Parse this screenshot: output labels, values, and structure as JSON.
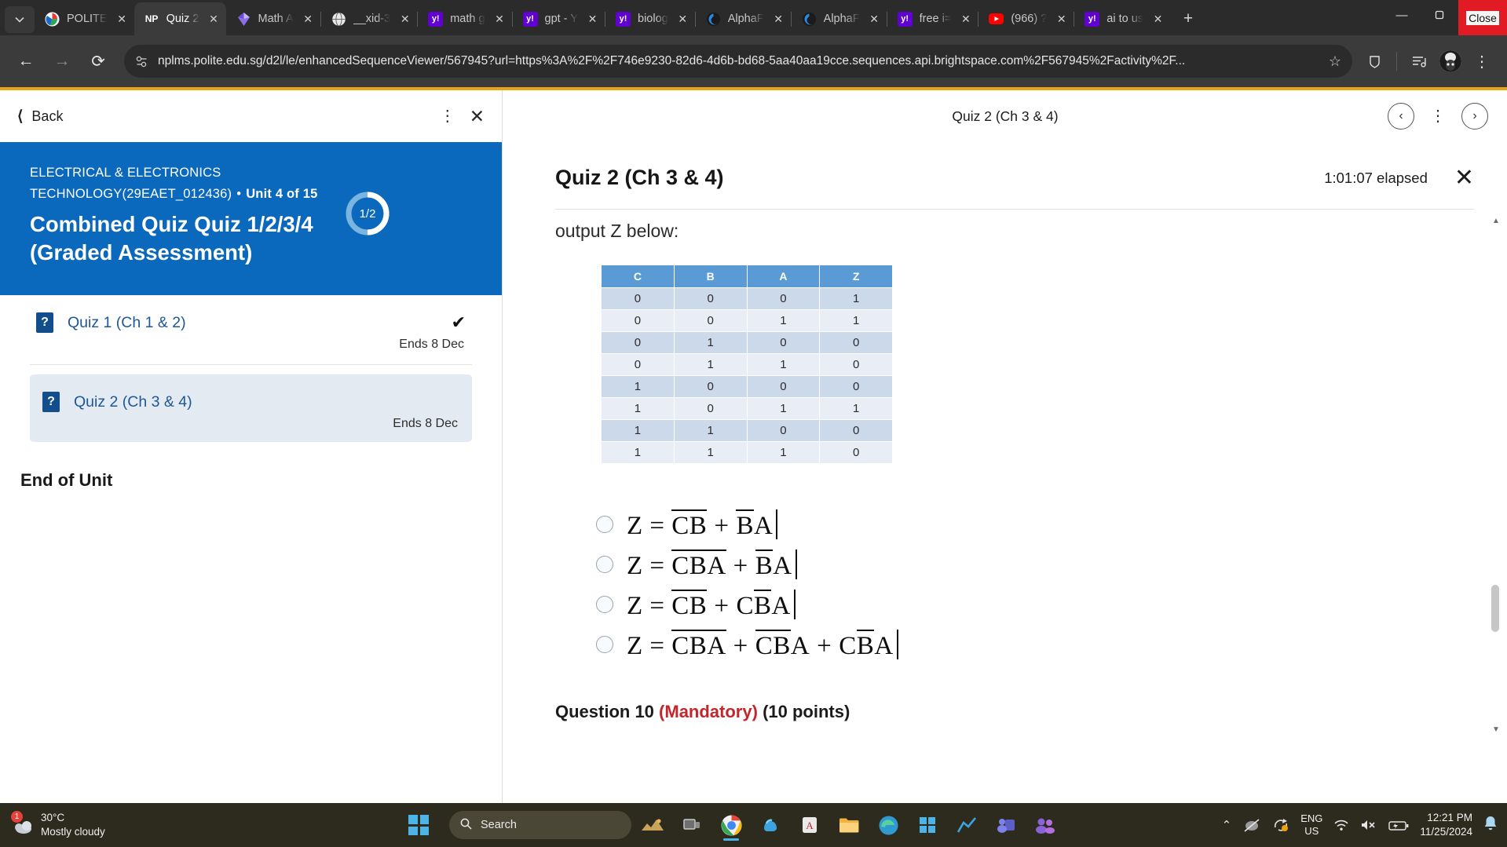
{
  "browser": {
    "tabs": [
      {
        "title": "POLITE",
        "favicon_kind": "polite",
        "active": false
      },
      {
        "title": "Quiz 2",
        "favicon_kind": "np",
        "active": true
      },
      {
        "title": "Math A",
        "favicon_kind": "gem",
        "active": false
      },
      {
        "title": "__xid-3",
        "favicon_kind": "globe",
        "active": false
      },
      {
        "title": "math g",
        "favicon_kind": "yahoo",
        "active": false
      },
      {
        "title": "gpt - Y",
        "favicon_kind": "yahoo",
        "active": false
      },
      {
        "title": "biolog",
        "favicon_kind": "yahoo",
        "active": false
      },
      {
        "title": "AlphaF",
        "favicon_kind": "alpha",
        "active": false
      },
      {
        "title": "AlphaF",
        "favicon_kind": "alpha",
        "active": false
      },
      {
        "title": "free i=",
        "favicon_kind": "yahoo",
        "active": false
      },
      {
        "title": "(966) ?",
        "favicon_kind": "youtube",
        "active": false
      },
      {
        "title": "ai to us",
        "favicon_kind": "yahoo",
        "active": false
      }
    ],
    "tab_close_label": "✕",
    "newtab_label": "+",
    "window": {
      "minimize": "—",
      "restore": "❐",
      "close_tooltip": "Close"
    },
    "nav": {
      "back": "←",
      "forward": "→",
      "reload": "⟳"
    },
    "url": "nplms.polite.edu.sg/d2l/le/enhancedSequenceViewer/567945?url=https%3A%2F%2F746e9230-82d6-4d6b-bd68-5aa40aa19cce.sequences.api.brightspace.com%2F567945%2Factivity%2F...",
    "star_label": "☆"
  },
  "left_panel": {
    "back_label": "Back",
    "hero": {
      "course_line1": "ELECTRICAL & ELECTRONICS",
      "course_line2": "TECHNOLOGY(29EAET_012436)",
      "unit_label": "Unit 4 of 15",
      "title": "Combined Quiz Quiz 1/2/3/4 (Graded Assessment)",
      "progress_label": "1/2",
      "progress_percent": 50,
      "bg_color": "#0a69bc"
    },
    "items": [
      {
        "title": "Quiz 1 (Ch 1 & 2)",
        "due": "Ends 8 Dec",
        "completed": true,
        "selected": false,
        "icon": "?"
      },
      {
        "title": "Quiz 2 (Ch 3 & 4)",
        "due": "Ends 8 Dec",
        "completed": false,
        "selected": true,
        "icon": "?"
      }
    ],
    "end_of_unit": "End of Unit"
  },
  "right_panel": {
    "header_title": "Quiz 2 (Ch 3 & 4)",
    "prev_label": "‹",
    "next_label": "›",
    "kebab_label": "⋮",
    "quiz_title": "Quiz 2 (Ch 3 & 4)",
    "timer": "1:01:07 elapsed",
    "close_label": "✕",
    "clipped_text": "output Z  below:",
    "truth_table": {
      "headers": [
        "C",
        "B",
        "A",
        "Z"
      ],
      "rows": [
        [
          "0",
          "0",
          "0",
          "1"
        ],
        [
          "0",
          "0",
          "1",
          "1"
        ],
        [
          "0",
          "1",
          "0",
          "0"
        ],
        [
          "0",
          "1",
          "1",
          "0"
        ],
        [
          "1",
          "0",
          "0",
          "0"
        ],
        [
          "1",
          "0",
          "1",
          "1"
        ],
        [
          "1",
          "1",
          "0",
          "0"
        ],
        [
          "1",
          "1",
          "1",
          "0"
        ]
      ],
      "header_bg": "#5b9bd5",
      "odd_bg": "#ccd9ea",
      "even_bg": "#e9eef6"
    },
    "options": [
      {
        "id": "opt1",
        "selected": false,
        "prefix": "Z =",
        "terms": [
          [
            "C̅",
            "B̅"
          ],
          [
            "B̅",
            "A"
          ]
        ]
      },
      {
        "id": "opt2",
        "selected": false,
        "prefix": "Z =",
        "terms": [
          [
            "C̅",
            "B̅",
            "A̅"
          ],
          [
            "B̅",
            "A"
          ]
        ]
      },
      {
        "id": "opt3",
        "selected": false,
        "prefix": "Z =",
        "terms": [
          [
            "C̅",
            "B̅"
          ],
          [
            "C",
            "B̅",
            "A"
          ]
        ]
      },
      {
        "id": "opt4",
        "selected": false,
        "prefix": "Z =",
        "terms": [
          [
            "C̅",
            "B̅",
            "A̅"
          ],
          [
            "C̅",
            "B̅",
            "A"
          ],
          [
            "C",
            "B̅",
            "A"
          ]
        ]
      }
    ],
    "question_heading": {
      "number": "Question 10",
      "mandatory": "(Mandatory)",
      "points": "(10 points)",
      "mandatory_color": "#c1272d"
    }
  },
  "taskbar": {
    "weather": {
      "temp": "30°C",
      "condition": "Mostly cloudy",
      "badge": "1"
    },
    "search_placeholder": "Search",
    "apps": [
      "start",
      "search",
      "widgets",
      "taskview",
      "chrome",
      "copilot",
      "acrobat",
      "explorer",
      "edge",
      "store",
      "graph",
      "teams",
      "people"
    ],
    "tray": {
      "chevron": "⌃",
      "language_line1": "ENG",
      "language_line2": "US",
      "time": "12:21 PM",
      "date": "11/25/2024",
      "volume_muted": true
    }
  }
}
